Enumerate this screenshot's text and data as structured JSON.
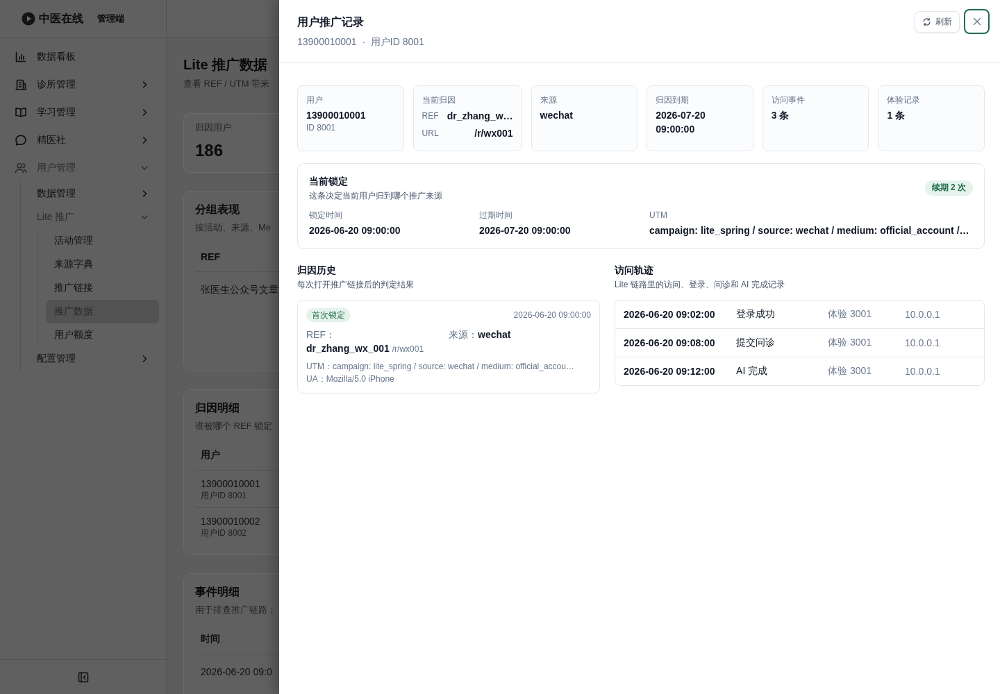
{
  "sidebar": {
    "brand": "中医在线",
    "tag": "管理端",
    "items": [
      {
        "label": "数据看板",
        "kind": "link",
        "selected": false
      },
      {
        "label": "诊所管理",
        "kind": "group",
        "expanded": false,
        "selected": false
      },
      {
        "label": "学习管理",
        "kind": "group",
        "expanded": false,
        "selected": false
      },
      {
        "label": "精医社",
        "kind": "group",
        "expanded": false,
        "selected": false
      },
      {
        "label": "用户管理",
        "kind": "group",
        "expanded": true,
        "selected": false,
        "children": [
          {
            "label": "数据管理",
            "kind": "group",
            "expanded": false,
            "selected": false
          },
          {
            "label": "Lite 推广",
            "kind": "group",
            "expanded": true,
            "selected": false,
            "children": [
              {
                "label": "活动管理",
                "kind": "link",
                "selected": false
              },
              {
                "label": "来源字典",
                "kind": "link",
                "selected": false
              },
              {
                "label": "推广链接",
                "kind": "link",
                "selected": false
              },
              {
                "label": "推广数据",
                "kind": "link",
                "selected": true
              },
              {
                "label": "用户额度",
                "kind": "link",
                "selected": false
              }
            ]
          },
          {
            "label": "配置管理",
            "kind": "group",
            "expanded": false,
            "selected": false
          }
        ]
      }
    ]
  },
  "page": {
    "title": "Lite 推广数据",
    "subtitle": "查看 REF / UTM 带来",
    "stat": {
      "label": "归因用户",
      "value": "186"
    },
    "sections": [
      {
        "title": "分组表现",
        "subtitle": "按活动、来源、Me",
        "columns": [
          "REF"
        ],
        "rows": [
          [
            {
              "text": "张医生公众号文章"
            }
          ]
        ]
      },
      {
        "title": "归因明细",
        "subtitle": "谁被哪个 REF 锁定",
        "columns": [
          "用户"
        ],
        "rows": [
          [
            {
              "text": "13900010001",
              "sub": "用户ID 8001"
            }
          ],
          [
            {
              "text": "13900010002",
              "sub": "用户ID 8002"
            }
          ]
        ]
      },
      {
        "title": "事件明细",
        "subtitle": "用于排查推广链路；",
        "columns": [
          "时间"
        ],
        "rows": [
          [
            {
              "text": "2026-06-20 09:0"
            }
          ]
        ]
      }
    ]
  },
  "drawer": {
    "title": "用户推广记录",
    "subtitle": "13900010001  ·  用户ID 8001",
    "refresh_button": {
      "label": "刷新"
    },
    "close_button": {
      "focused": true
    },
    "summary": [
      {
        "kind": "value",
        "label": "用户",
        "value": "13900010001",
        "sub": "ID 8001"
      },
      {
        "kind": "pairs",
        "label": "当前归因",
        "pairs": [
          {
            "key": "REF",
            "value": "dr_zhang_w…"
          },
          {
            "key": "URL",
            "value": "/r/wx001"
          }
        ]
      },
      {
        "kind": "value",
        "label": "来源",
        "value": "wechat"
      },
      {
        "kind": "value",
        "label": "归因到期",
        "value": "2026-07-20 09:00:00"
      },
      {
        "kind": "value",
        "label": "访问事件",
        "value": "3 条"
      },
      {
        "kind": "value",
        "label": "体验记录",
        "value": "1 条"
      }
    ],
    "lock": {
      "title": "当前锁定",
      "description": "这条决定当前用户归到哪个推广来源",
      "badge": "续期 2 次",
      "fields": [
        {
          "label": "锁定时间",
          "value": "2026-06-20 09:00:00"
        },
        {
          "label": "过期时间",
          "value": "2026-07-20 09:00:00"
        },
        {
          "label": "UTM",
          "value": "campaign: lite_spring / source: wechat / medium: official_account /…"
        }
      ]
    },
    "history": {
      "title": "归因历史",
      "subtitle": "每次打开推广链接后的判定结果",
      "entries": [
        {
          "badge": "首次锁定",
          "time": "2026-06-20 09:00:00",
          "ref_label": "REF：",
          "ref": "dr_zhang_wx_001",
          "url": "/r/wx001",
          "source_label": "来源：",
          "source": "wechat",
          "utm": "UTM：campaign: lite_spring / source: wechat / medium: official_accou…",
          "ua": "UA：Mozilla/5.0 iPhone"
        }
      ]
    },
    "track": {
      "title": "访问轨迹",
      "subtitle": "Lite 链路里的访问、登录、问诊和 AI 完成记录",
      "rows": [
        {
          "time": "2026-06-20 09:02:00",
          "event": "登录成功",
          "session": "体验 3001",
          "ip": "10.0.0.1"
        },
        {
          "time": "2026-06-20 09:08:00",
          "event": "提交问诊",
          "session": "体验 3001",
          "ip": "10.0.0.1"
        },
        {
          "time": "2026-06-20 09:12:00",
          "event": "AI 完成",
          "session": "体验 3001",
          "ip": "10.0.0.1"
        }
      ]
    }
  }
}
